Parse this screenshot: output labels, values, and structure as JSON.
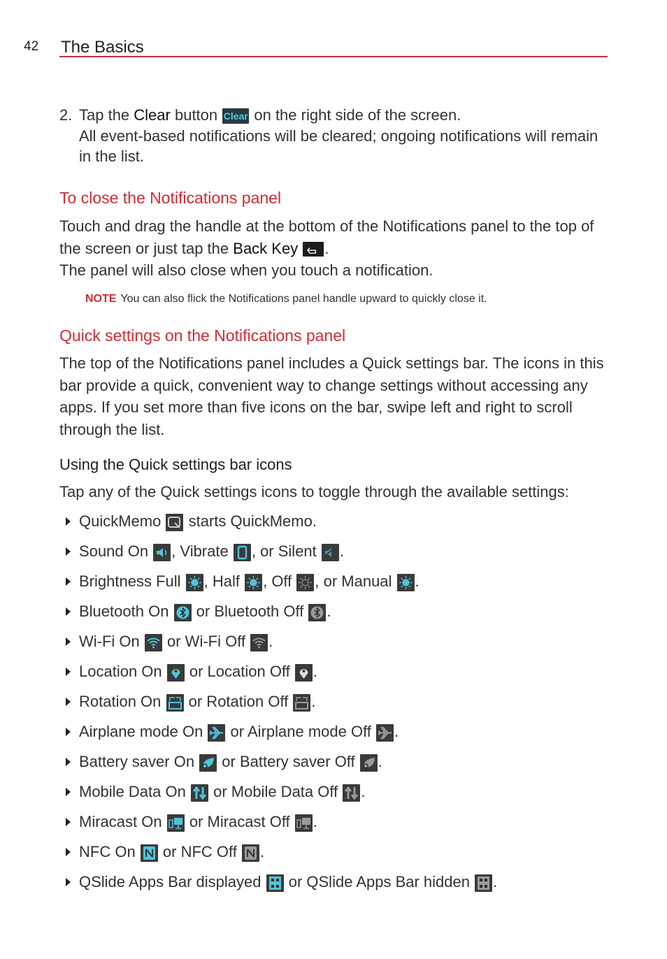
{
  "header": {
    "page_number": "42",
    "title": "The Basics"
  },
  "step2": {
    "number": "2.",
    "line1_pre": "Tap the ",
    "clear_label": "Clear",
    "line1_mid": " button ",
    "clear_icon_text": "Clear",
    "line1_post": " on the right side of the screen.",
    "line2": "All event-based notifications will be cleared; ongoing notifications will remain in the list."
  },
  "close_section": {
    "heading": "To close the Notifications panel",
    "p1_pre": "Touch and drag the handle at the bottom of the Notifications panel to the top of the screen or just tap the ",
    "back_key_label": "Back Key",
    "p1_post": ".",
    "p2": "The panel will also close when you touch a notification.",
    "note_label": "NOTE",
    "note_text": "You can also flick the Notifications panel handle upward to quickly close it."
  },
  "quick_section": {
    "heading": "Quick settings on the Notifications panel",
    "paragraph": "The top of the Notifications panel includes a Quick settings bar. The icons in this bar provide a quick, convenient way to change settings without accessing any apps. If you set more than five icons on the bar, swipe left and right to scroll through the list."
  },
  "using_section": {
    "heading": "Using the Quick settings bar icons",
    "intro": "Tap any of the Quick settings icons to toggle through the available settings:"
  },
  "bullets": [
    {
      "parts": [
        {
          "t": "QuickMemo "
        },
        {
          "icon": "quickmemo-icon"
        },
        {
          "t": " starts QuickMemo."
        }
      ]
    },
    {
      "parts": [
        {
          "t": "Sound On "
        },
        {
          "icon": "sound-on-icon"
        },
        {
          "t": ", Vibrate "
        },
        {
          "icon": "vibrate-icon"
        },
        {
          "t": ", or Silent "
        },
        {
          "icon": "silent-icon"
        },
        {
          "t": "."
        }
      ]
    },
    {
      "parts": [
        {
          "t": "Brightness Full "
        },
        {
          "icon": "brightness-full-icon"
        },
        {
          "t": ", Half "
        },
        {
          "icon": "brightness-half-icon"
        },
        {
          "t": ", Off "
        },
        {
          "icon": "brightness-off-icon"
        },
        {
          "t": ", or Manual "
        },
        {
          "icon": "brightness-manual-icon"
        },
        {
          "t": "."
        }
      ]
    },
    {
      "parts": [
        {
          "t": "Bluetooth On "
        },
        {
          "icon": "bluetooth-on-icon"
        },
        {
          "t": " or Bluetooth Off "
        },
        {
          "icon": "bluetooth-off-icon"
        },
        {
          "t": "."
        }
      ]
    },
    {
      "parts": [
        {
          "t": "Wi-Fi On "
        },
        {
          "icon": "wifi-on-icon"
        },
        {
          "t": " or Wi-Fi Off "
        },
        {
          "icon": "wifi-off-icon"
        },
        {
          "t": "."
        }
      ]
    },
    {
      "parts": [
        {
          "t": "Location On "
        },
        {
          "icon": "location-on-icon"
        },
        {
          "t": " or Location Off "
        },
        {
          "icon": "location-off-icon"
        },
        {
          "t": "."
        }
      ]
    },
    {
      "parts": [
        {
          "t": "Rotation On "
        },
        {
          "icon": "rotation-on-icon"
        },
        {
          "t": " or Rotation Off "
        },
        {
          "icon": "rotation-off-icon"
        },
        {
          "t": "."
        }
      ]
    },
    {
      "parts": [
        {
          "t": "Airplane mode On "
        },
        {
          "icon": "airplane-on-icon"
        },
        {
          "t": " or Airplane mode Off "
        },
        {
          "icon": "airplane-off-icon"
        },
        {
          "t": "."
        }
      ]
    },
    {
      "parts": [
        {
          "t": "Battery saver On "
        },
        {
          "icon": "battery-saver-on-icon"
        },
        {
          "t": " or Battery saver Off "
        },
        {
          "icon": "battery-saver-off-icon"
        },
        {
          "t": "."
        }
      ]
    },
    {
      "parts": [
        {
          "t": "Mobile Data On "
        },
        {
          "icon": "mobile-data-on-icon"
        },
        {
          "t": " or Mobile Data Off "
        },
        {
          "icon": "mobile-data-off-icon"
        },
        {
          "t": "."
        }
      ]
    },
    {
      "parts": [
        {
          "t": "Miracast On "
        },
        {
          "icon": "miracast-on-icon"
        },
        {
          "t": " or Miracast Off "
        },
        {
          "icon": "miracast-off-icon"
        },
        {
          "t": "."
        }
      ]
    },
    {
      "parts": [
        {
          "t": "NFC On "
        },
        {
          "icon": "nfc-on-icon"
        },
        {
          "t": " or NFC Off "
        },
        {
          "icon": "nfc-off-icon"
        },
        {
          "t": "."
        }
      ]
    },
    {
      "parts": [
        {
          "t": "QSlide Apps Bar displayed "
        },
        {
          "icon": "qslide-displayed-icon"
        },
        {
          "t": " or QSlide Apps Bar hidden "
        },
        {
          "icon": "qslide-hidden-icon"
        },
        {
          "t": "."
        }
      ]
    }
  ],
  "colors": {
    "accent_red": "#d52b35",
    "icon_on": "#4fc3d9",
    "icon_off": "#9a9a9a",
    "icon_bg": "#3a3a3a"
  }
}
